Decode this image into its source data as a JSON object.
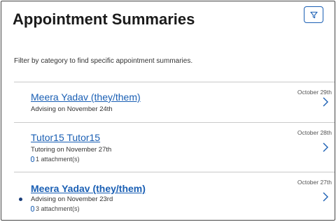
{
  "header": {
    "title": "Appointment Summaries",
    "filter_icon": "filter-icon"
  },
  "subtitle": "Filter by category to find specific appointment summaries.",
  "appointments": [
    {
      "name": "Meera Yadav (they/them)",
      "detail": "Advising on November 24th",
      "date": "October 29th",
      "attachments": "",
      "unread": false
    },
    {
      "name": "Tutor15 Tutor15",
      "detail": "Tutoring on November 27th",
      "date": "October 28th",
      "attachments": "1 attachment(s)",
      "unread": false
    },
    {
      "name": "Meera Yadav (they/them)",
      "detail": "Advising on November 23rd",
      "date": "October 27th",
      "attachments": "3 attachment(s)",
      "unread": true
    }
  ],
  "colors": {
    "link": "#1a5fb4",
    "unread_dot": "#1a3d7a"
  }
}
